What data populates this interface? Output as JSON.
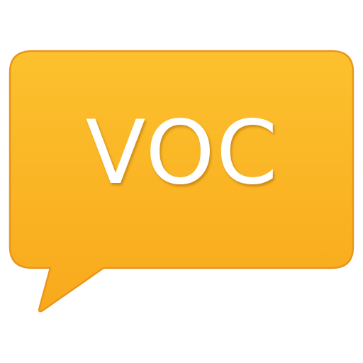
{
  "icon": {
    "name": "speech-bubble-icon",
    "label": "VOC",
    "colors": {
      "fill_top": "#fcc12e",
      "fill_bottom": "#f8a91c",
      "border": "#e9961a",
      "text": "#ffffff"
    }
  }
}
